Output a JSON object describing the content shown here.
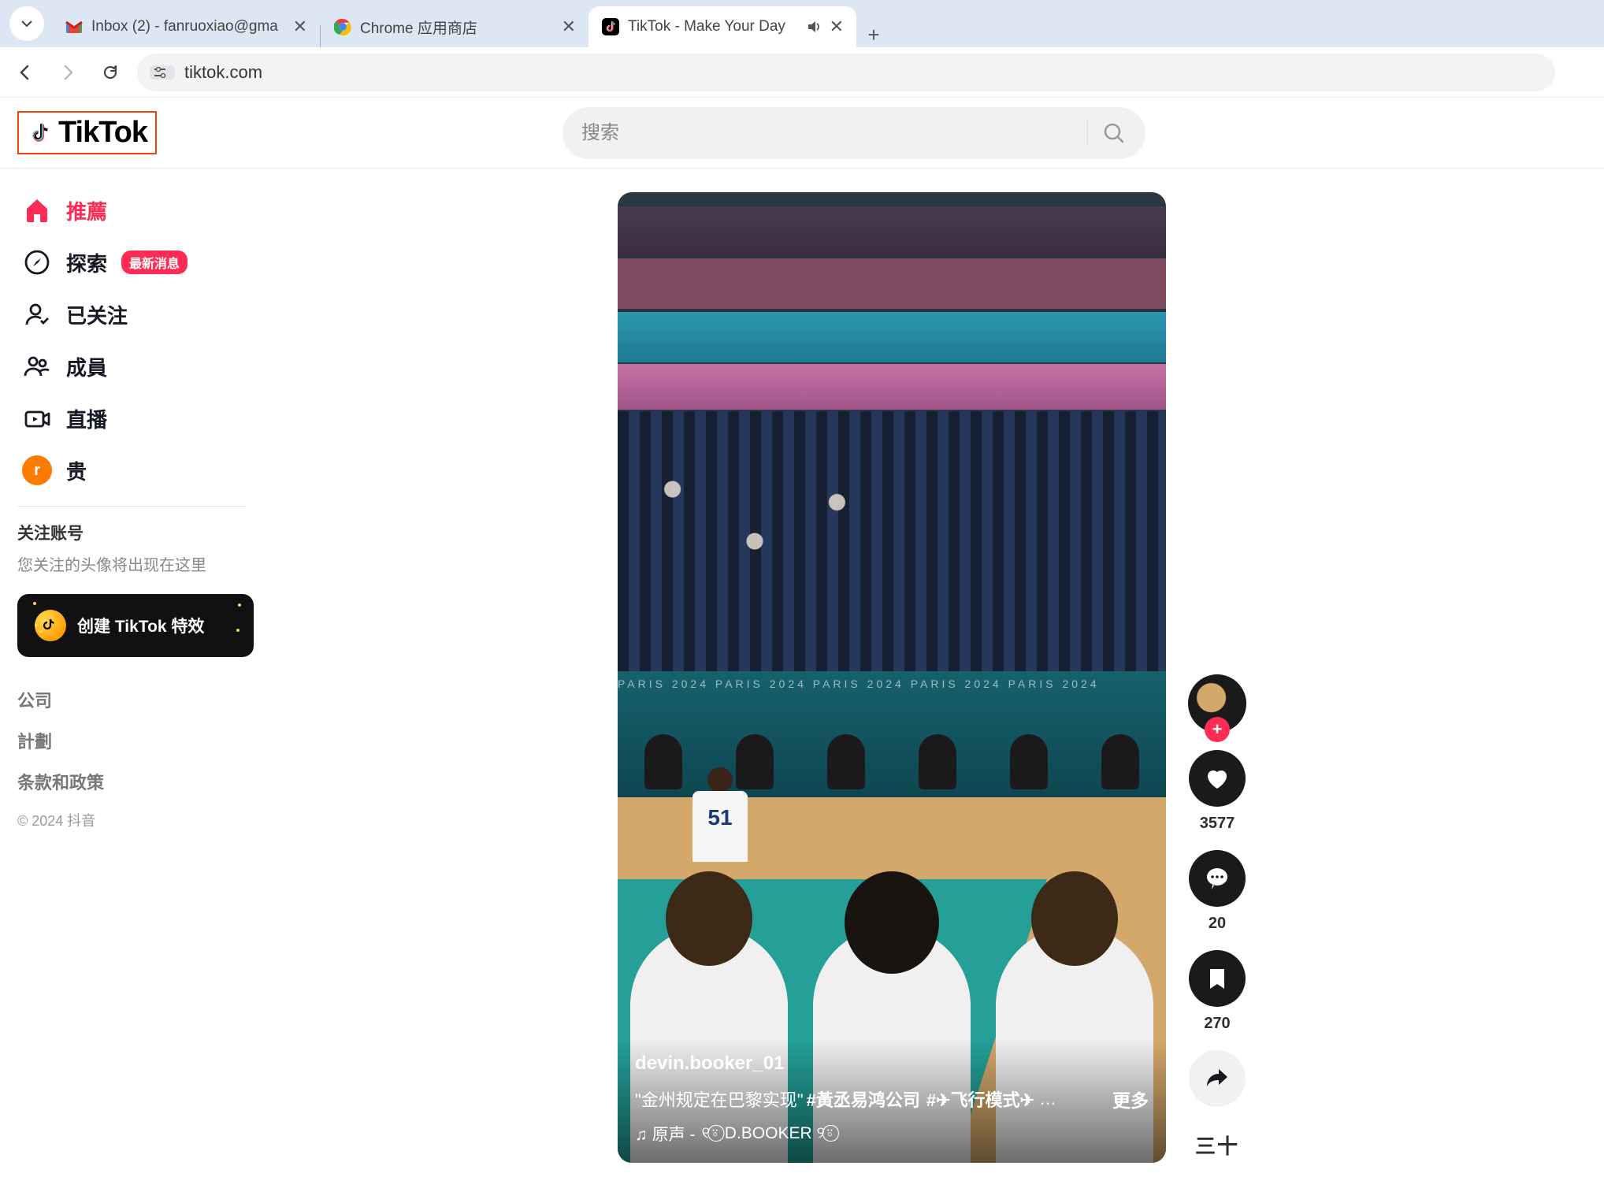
{
  "browser": {
    "tabs": [
      {
        "title": "Inbox (2) - fanruoxiao@gma",
        "active": false
      },
      {
        "title": "Chrome 应用商店",
        "active": false
      },
      {
        "title": "TikTok - Make Your Day",
        "active": true,
        "audio": true
      }
    ],
    "url": "tiktok.com"
  },
  "header": {
    "logo_text": "TikTok",
    "search_placeholder": "搜索"
  },
  "sidebar": {
    "items": [
      {
        "key": "recommend",
        "label": "推薦",
        "active": true
      },
      {
        "key": "explore",
        "label": "探索",
        "badge": "最新消息"
      },
      {
        "key": "following",
        "label": "已关注"
      },
      {
        "key": "friends",
        "label": "成員"
      },
      {
        "key": "live",
        "label": "直播"
      },
      {
        "key": "profile",
        "label": "贵",
        "avatar_initial": "r"
      }
    ],
    "follow_heading": "关注账号",
    "follow_empty": "您关注的头像将出现在这里",
    "create_fx_label": "创建 TikTok 特效",
    "footer": {
      "company": "公司",
      "plan": "計劃",
      "terms": "条款和政策",
      "copyright": "© 2024 抖音"
    }
  },
  "video": {
    "username": "devin.booker_01",
    "caption_prefix": "\"金州规定在巴黎实现\"",
    "hashtag1": "#黃丞易鸿公司",
    "hashtag2": "#✈飞行模式✈",
    "more_label": "更多",
    "sound_prefix": "♫ 原声 - ",
    "sound_name": "୧⍤⃝ D.BOOKER ୨⍤⃝"
  },
  "actions": {
    "like_count": "3577",
    "comment_count": "20",
    "bookmark_count": "270",
    "menu_glyph": "三十"
  }
}
